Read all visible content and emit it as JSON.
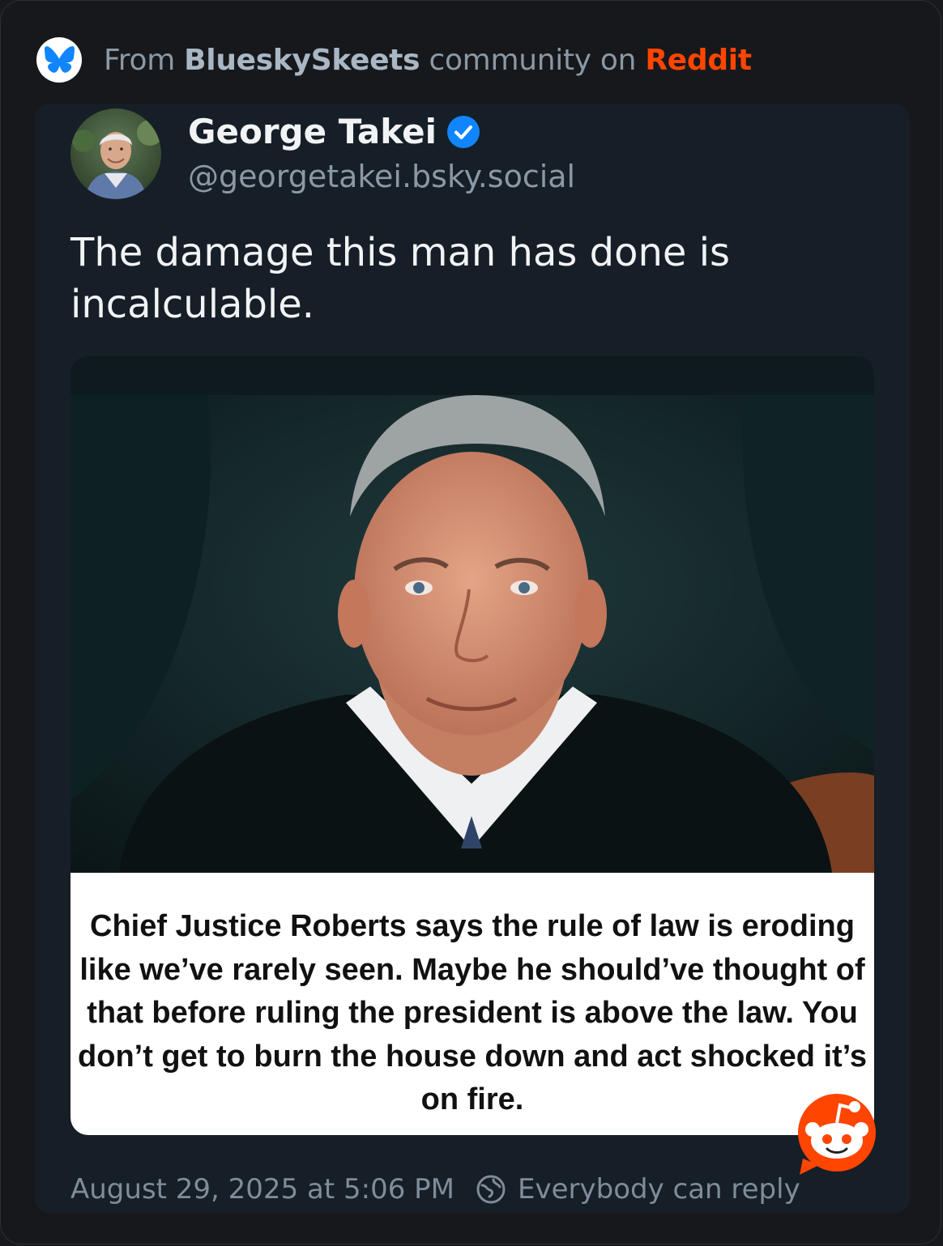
{
  "source": {
    "prefix": "From",
    "community": "BlueskySkeets",
    "middle": "community on",
    "platform": "Reddit",
    "icon": "bluesky-butterfly-icon"
  },
  "post": {
    "author_name": "George Takei",
    "author_handle": "@georgetakei.bsky.social",
    "verified_icon": "verified-check-icon",
    "text": "The damage this man has done is incalculable.",
    "image": {
      "caption": "Chief Justice Roberts says the rule of law is eroding like we’ve rarely seen. Maybe he should’ve thought of that before ruling the president is above the law. You don’t get to burn the house down and act shocked it’s on fire."
    },
    "timestamp": "August 29, 2025 at 5:06 PM",
    "reply_setting": "Everybody can reply",
    "reply_icon": "globe-icon"
  },
  "colors": {
    "reddit": "#ff4500",
    "bluesky": "#1185fe",
    "background": "#16181c",
    "card": "#161e27"
  }
}
